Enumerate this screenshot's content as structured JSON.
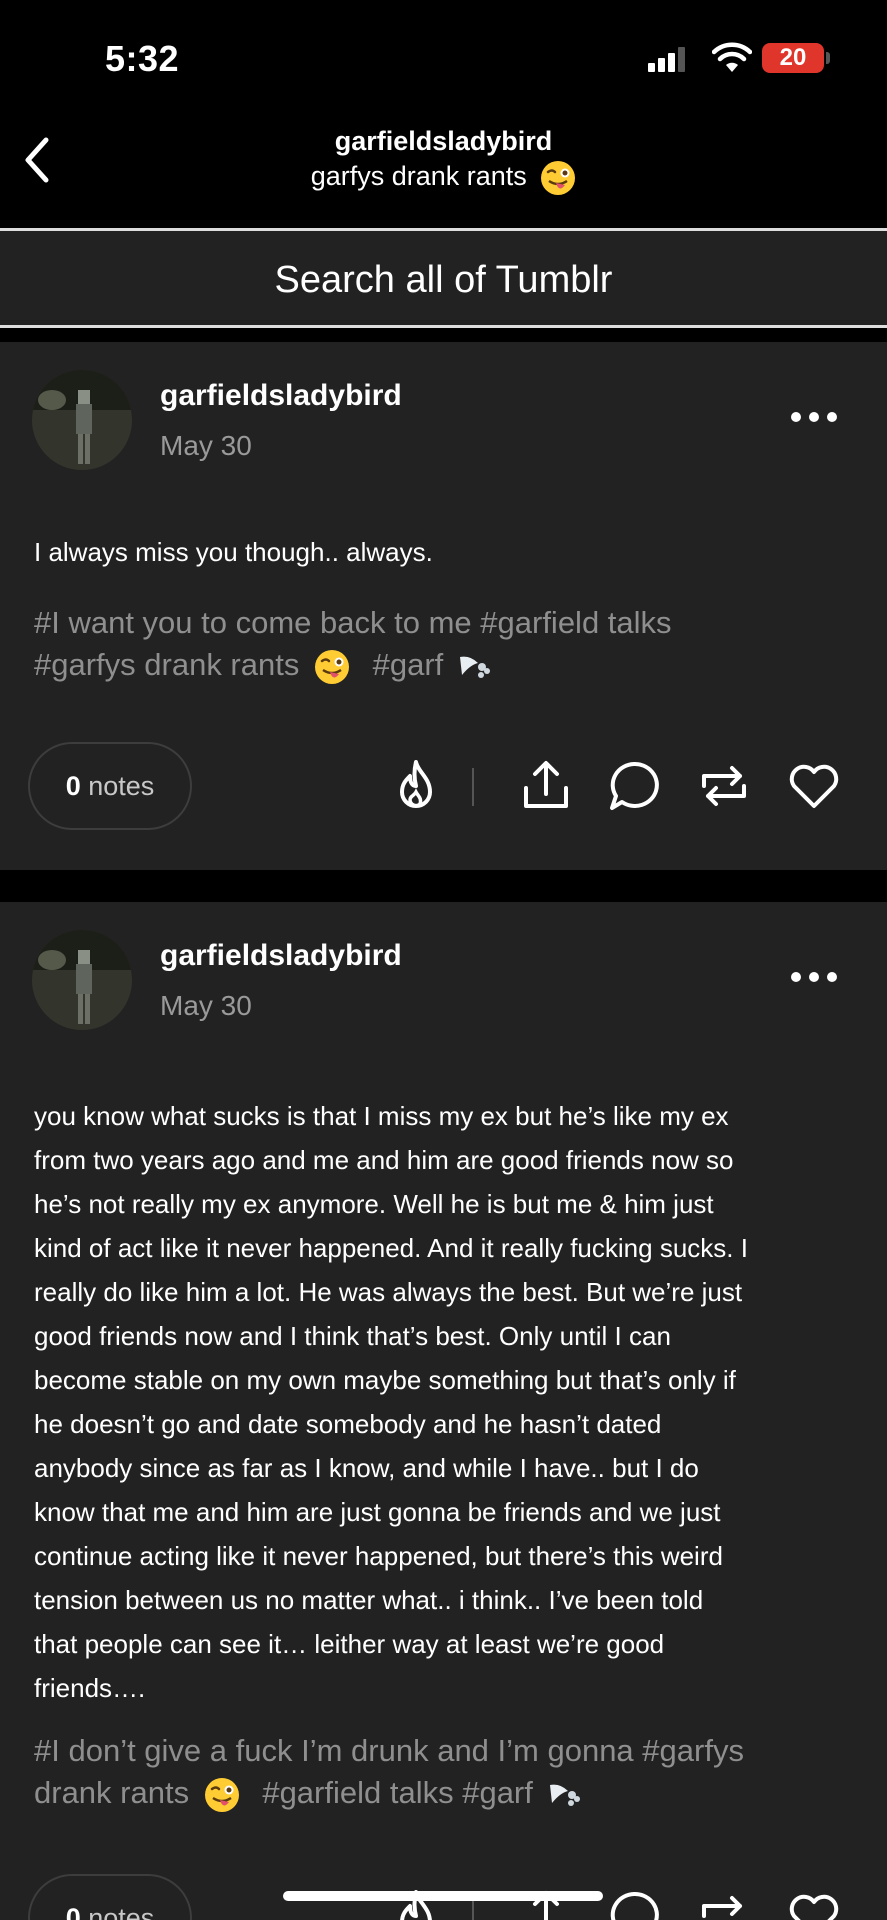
{
  "status_bar": {
    "time": "5:32",
    "battery": "20"
  },
  "header": {
    "blog_name": "garfieldsladybird",
    "subtitle": "garfys drank rants"
  },
  "search": {
    "label": "Search all of Tumblr"
  },
  "posts": [
    {
      "author": "garfieldsladybird",
      "date": "May 30",
      "body": "I always miss you though.. always.",
      "tags_line1": "#I want you to come back to me  #garfield talks",
      "tags_line2a": "#garfys drank rants",
      "tags_line2b": "#garf",
      "notes_count": "0",
      "notes_label": "notes"
    },
    {
      "author": "garfieldsladybird",
      "date": "May 30",
      "body_lines": [
        "you know what sucks is that I miss my ex but he’s like my ex",
        "from two years ago and me and him are good friends now so",
        "he’s not really my ex anymore. Well he is but me & him just",
        "kind of act like it never happened. And it really fucking sucks. I",
        "really do like him a lot. He was always the best. But we’re just",
        "good friends now and I think that’s best. Only until I can",
        "become stable on my own maybe something but that’s only if",
        "he doesn’t go and date somebody and he hasn’t dated",
        "anybody since as far as I know, and while I have.. but I do",
        "know that me and him are just gonna be friends and we just",
        "continue acting like it never happened, but there’s this weird",
        "tension between us no matter what.. i think.. I’ve been told",
        "that people can see it… leither way at least we’re good",
        "friends…."
      ],
      "tags_line1": "#I don’t give a fuck I’m drunk and I’m gonna  #garfys",
      "tags_line2a": "drank rants",
      "tags_line2b": "#garfield talks  #garf",
      "notes_count": "0",
      "notes_label": "notes"
    }
  ],
  "icons": {
    "back": "chevron-left-icon",
    "more": "more-dots-icon",
    "actions": [
      "blaze-icon",
      "share-icon",
      "reply-icon",
      "reblog-icon",
      "like-icon"
    ]
  },
  "colors": {
    "background": "#000000",
    "card": "#222222",
    "tag_text": "#8f8f8f",
    "battery": "#e0352b"
  }
}
